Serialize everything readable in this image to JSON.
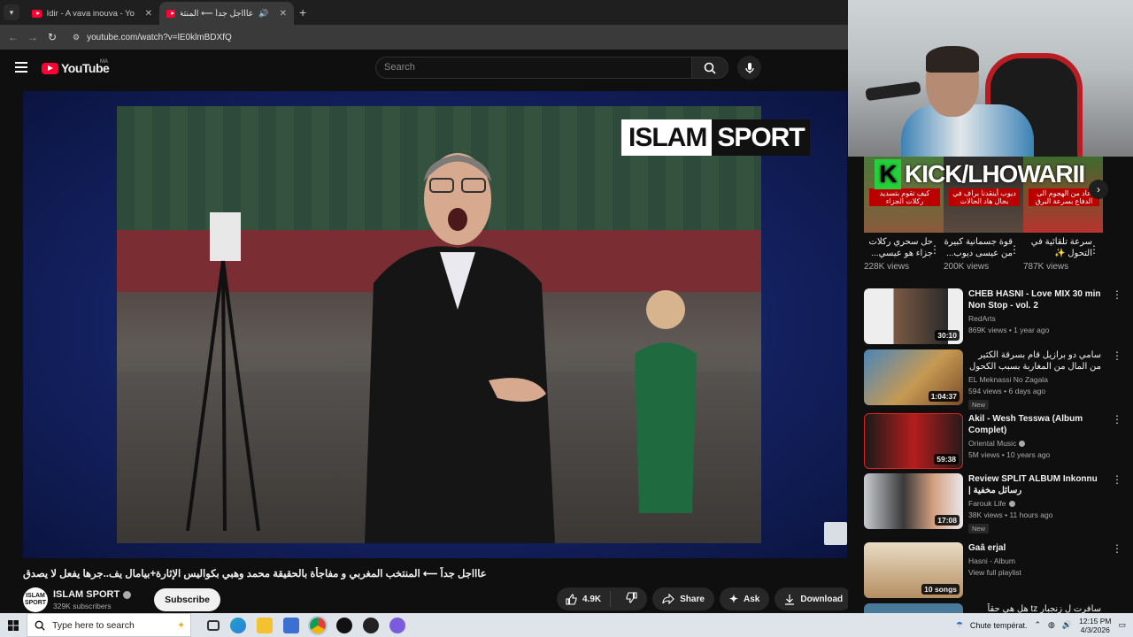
{
  "browser": {
    "tabs": [
      {
        "title": "Idir - A vava inouva - YouTube",
        "active": false
      },
      {
        "title": "عاااجل جداً ⟵ المنتخب المغر",
        "active": true
      }
    ],
    "url": "youtube.com/watch?v=lE0klmBDXfQ"
  },
  "youtube": {
    "logo": "YouTube",
    "region": "MA",
    "search_placeholder": "Search"
  },
  "player": {
    "watermark_left": "ISLAM",
    "watermark_right": "SPORT"
  },
  "video": {
    "title": "عاااجل جداً ⟵ المنتخب المغربي و مفاجأة بالحقيقة محمد وهبي بكواليس الإثارة+بيامال يف..جرها يفعل لا يصدق",
    "channel_name": "ISLAM SPORT",
    "channel_avatar": "ISLAM SPORT",
    "subscribers": "329K subscribers",
    "subscribe_label": "Subscribe",
    "likes": "4.9K",
    "share_label": "Share",
    "ask_label": "Ask",
    "download_label": "Download"
  },
  "sidebar": {
    "banner": "KICK/LHOWARII",
    "shorts": [
      {
        "caption": "كيف تقوم بتسديد ركلات الجزاء",
        "title": "حل سحري ركلات جزاء هو عيسي...",
        "views": "228K views"
      },
      {
        "caption": "ديوب أينقدنا براف في بحال هاد الحالات",
        "title": "قوة جسمانية كبيرة من عيسى ديوب...",
        "views": "200K views"
      },
      {
        "caption": "عاد من الهجوم الى الدفاع بسرعة البرق",
        "title": "سرعة تلقائية في التحول ✨",
        "views": "787K views"
      }
    ],
    "recommendations": [
      {
        "title": "CHEB HASNI - Love MIX 30 min Non Stop - vol. 2",
        "channel": "RedArts",
        "verified": false,
        "meta": "869K views • 1 year ago",
        "duration": "30:10",
        "badge": "",
        "rtl": false
      },
      {
        "title": "سامي دو برازيل قام بسرقة الكثير من المال من المغاربة بسبب الكحول والكرة! #world",
        "channel": "EL Meknassi No Zagala",
        "verified": false,
        "meta": "594 views • 6 days ago",
        "duration": "1:04:37",
        "badge": "New",
        "rtl": true
      },
      {
        "title": "Akil - Wesh Tesswa (Album Complet)",
        "channel": "Oriental Music",
        "verified": true,
        "meta": "5M views • 10 years ago",
        "duration": "59:38",
        "badge": "",
        "rtl": false
      },
      {
        "title": "Review SPLIT ALBUM Inkonnu | رسائل مخفية",
        "channel": "Farouk Life",
        "verified": true,
        "meta": "38K views • 11 hours ago",
        "duration": "17:08",
        "badge": "New",
        "rtl": false
      },
      {
        "title": "Gaâ erjal",
        "channel": "Hasni - Album",
        "verified": false,
        "meta": "View full playlist",
        "duration": "10 songs",
        "badge": "",
        "rtl": false
      },
      {
        "title": "سافرت ل زنجبار tz هل هي حقاً مافيه",
        "channel": "",
        "verified": false,
        "meta": "",
        "duration": "",
        "badge": "",
        "rtl": true
      }
    ]
  },
  "taskbar": {
    "search_placeholder": "Type here to search",
    "weather": "Chute températ.",
    "time": "12:15 PM",
    "date": "4/3/2026"
  }
}
